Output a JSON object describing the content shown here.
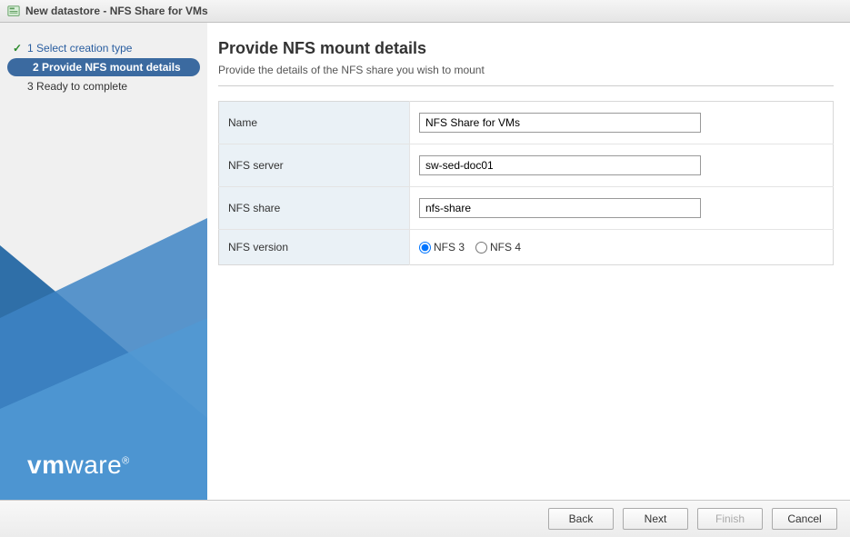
{
  "titlebar": {
    "title": "New datastore - NFS Share for VMs"
  },
  "wizard": {
    "steps": [
      {
        "num": "1",
        "label": "Select creation type",
        "state": "completed"
      },
      {
        "num": "2",
        "label": "Provide NFS mount details",
        "state": "current"
      },
      {
        "num": "3",
        "label": "Ready to complete",
        "state": "pending"
      }
    ]
  },
  "content": {
    "heading": "Provide NFS mount details",
    "subtitle": "Provide the details of the NFS share you wish to mount",
    "fields": {
      "name_label": "Name",
      "name_value": "NFS Share for VMs",
      "server_label": "NFS server",
      "server_value": "sw-sed-doc01",
      "share_label": "NFS share",
      "share_value": "nfs-share",
      "version_label": "NFS version",
      "version_opt1": "NFS 3",
      "version_opt2": "NFS 4",
      "version_selected": "NFS 3"
    }
  },
  "footer": {
    "back": "Back",
    "next": "Next",
    "finish": "Finish",
    "cancel": "Cancel"
  },
  "logo": {
    "part1": "vm",
    "part2": "ware",
    "reg": "®"
  }
}
